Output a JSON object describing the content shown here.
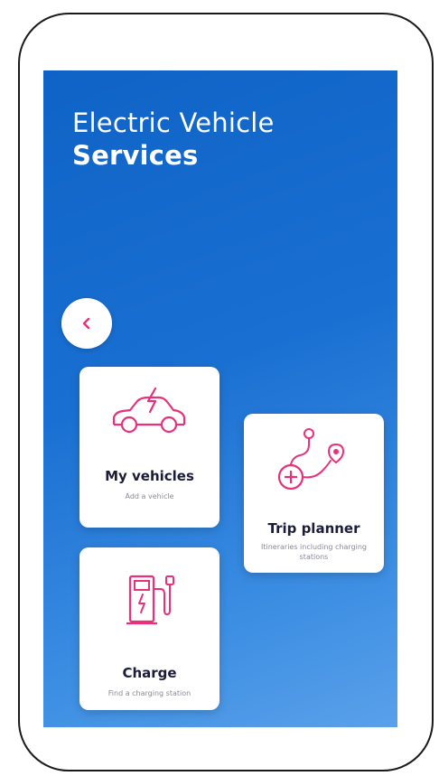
{
  "header": {
    "title_line1": "Electric Vehicle",
    "title_line2": "Services"
  },
  "back_button": {
    "icon": "chevron-left-icon"
  },
  "cards": {
    "my_vehicles": {
      "title": "My vehicles",
      "subtitle": "Add a vehicle",
      "icon": "ev-car-icon"
    },
    "trip_planner": {
      "title": "Trip planner",
      "subtitle": "Itineraries including charging stations",
      "icon": "route-pin-icon"
    },
    "charge": {
      "title": "Charge",
      "subtitle": "Find a charging station",
      "icon": "charging-station-icon"
    }
  },
  "colors": {
    "accent": "#e8317a",
    "background_top": "#0f63c6",
    "background_bottom": "#5aa0ea",
    "card": "#ffffff",
    "title_text": "#1b1b3a"
  }
}
